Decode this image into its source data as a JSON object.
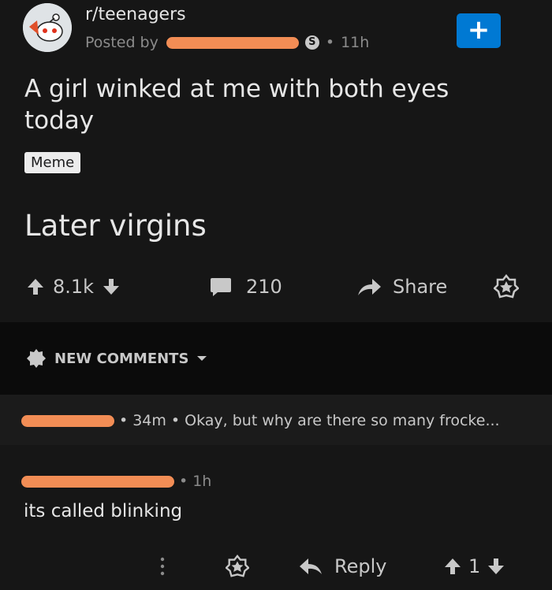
{
  "header": {
    "subreddit": "r/teenagers",
    "posted_by_prefix": "Posted by",
    "time_ago": "11h",
    "join_label": "+"
  },
  "post": {
    "title": "A girl winked at me with both eyes today",
    "flair": "Meme",
    "body": "Later virgins"
  },
  "actions": {
    "score": "8.1k",
    "comments": "210",
    "share": "Share"
  },
  "comments_sort": {
    "label": "NEW COMMENTS"
  },
  "comments": [
    {
      "time_ago": "34m",
      "text": "Okay, but why are there so many frocke..."
    },
    {
      "time_ago": "1h",
      "text": "its called blinking",
      "reply_label": "Reply",
      "score": "1"
    }
  ],
  "colors": {
    "background": "#161616",
    "accent_blue": "#0079d3",
    "redaction": "#f28d55"
  }
}
